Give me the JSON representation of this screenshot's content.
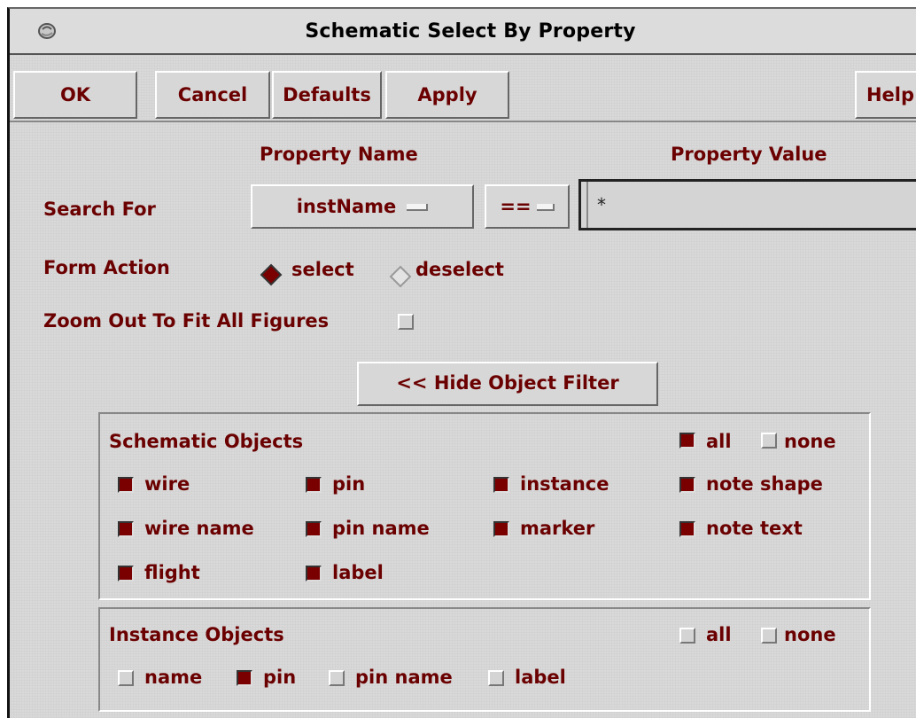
{
  "window": {
    "title": "Schematic Select By Property"
  },
  "buttons": {
    "ok": "OK",
    "cancel": "Cancel",
    "defaults": "Defaults",
    "apply": "Apply",
    "help": "Help"
  },
  "headers": {
    "property_name": "Property Name",
    "property_value": "Property Value"
  },
  "search": {
    "label": "Search For",
    "property": "instName",
    "operator": "==",
    "value": "*"
  },
  "form_action": {
    "label": "Form Action",
    "options": [
      "select",
      "deselect"
    ],
    "selected": "select"
  },
  "zoom": {
    "label": "Zoom Out To Fit All Figures",
    "checked": false
  },
  "filter_button": "<< Hide Object Filter",
  "schematic_objects": {
    "title": "Schematic Objects",
    "all": {
      "label": "all",
      "checked": true
    },
    "none": {
      "label": "none",
      "checked": false
    },
    "items": [
      {
        "label": "wire",
        "checked": true
      },
      {
        "label": "pin",
        "checked": true
      },
      {
        "label": "instance",
        "checked": true
      },
      {
        "label": "note shape",
        "checked": true
      },
      {
        "label": "wire name",
        "checked": true
      },
      {
        "label": "pin name",
        "checked": true
      },
      {
        "label": "marker",
        "checked": true
      },
      {
        "label": "note text",
        "checked": true
      },
      {
        "label": "flight",
        "checked": true
      },
      {
        "label": "label",
        "checked": true
      }
    ]
  },
  "instance_objects": {
    "title": "Instance Objects",
    "all": {
      "label": "all",
      "checked": false
    },
    "none": {
      "label": "none",
      "checked": false
    },
    "items": [
      {
        "label": "name",
        "checked": false
      },
      {
        "label": "pin",
        "checked": true
      },
      {
        "label": "pin name",
        "checked": false
      },
      {
        "label": "label",
        "checked": false
      }
    ]
  },
  "colors": {
    "label": "#6b0000",
    "checked": "#7a0000",
    "panel": "#d9d9d9"
  }
}
